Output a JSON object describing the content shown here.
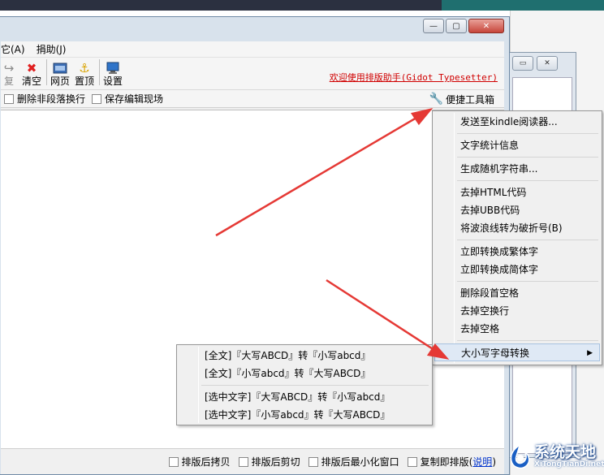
{
  "menubar": {
    "items": [
      "它(A)",
      "捐助(J)"
    ]
  },
  "toolbar": {
    "buttons": [
      {
        "label": "复",
        "icon": "redo-icon"
      },
      {
        "label": "清空",
        "icon": "clear-x-icon"
      },
      {
        "label": "网页",
        "icon": "webpage-icon"
      },
      {
        "label": "置顶",
        "icon": "pin-top-icon"
      },
      {
        "label": "设置",
        "icon": "settings-monitor-icon"
      }
    ],
    "welcome": "欢迎使用排版助手(Gidot Typesetter)"
  },
  "options": {
    "delete_nonpara": "删除非段落换行",
    "save_edit": "保存编辑现场",
    "toolbox": "便捷工具箱"
  },
  "context_menu": {
    "send_kindle": "发送至kindle阅读器...",
    "text_stats": "文字统计信息",
    "random_string": "生成随机字符串...",
    "remove_html": "去掉HTML代码",
    "remove_ubb": "去掉UBB代码",
    "tilde_to_dash": "将波浪线转为破折号(B)",
    "to_traditional": "立即转换成繁体字",
    "to_simplified": "立即转换成简体字",
    "remove_leading_spaces": "删除段首空格",
    "remove_blank_lines": "去掉空换行",
    "remove_spaces": "去掉空格",
    "case_convert": "大小写字母转换"
  },
  "submenu": {
    "all_upper_to_lower": "[全文]『大写ABCD』转『小写abcd』",
    "all_lower_to_upper": "[全文]『小写abcd』转『大写ABCD』",
    "sel_upper_to_lower": "[选中文字]『大写ABCD』转『小写abcd』",
    "sel_lower_to_upper": "[选中文字]『小写abcd』转『大写ABCD』"
  },
  "statusbar": {
    "copy_after": "排版后拷贝",
    "cut_after": "排版后剪切",
    "minimize_after": "排版后最小化窗口",
    "paste_instant": "复制即排版",
    "help_link": "说明"
  },
  "watermark": {
    "title": "系统天地",
    "subtitle": "XiTongTianDi.net"
  },
  "colors": {
    "welcome_red": "#d00000",
    "arrow_red": "#e53935",
    "link_blue": "#0033cc"
  }
}
